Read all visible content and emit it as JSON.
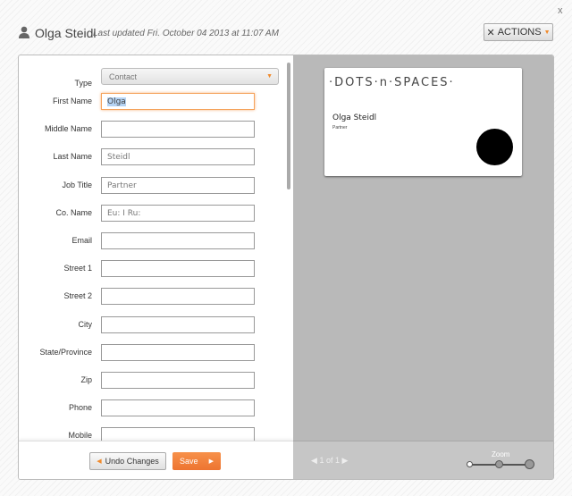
{
  "header": {
    "title": "Olga Steidl",
    "updated": "Last updated Fri. October 04 2013 at 11:07 AM",
    "actions_label": "ACTIONS",
    "close": "x"
  },
  "form": {
    "type": {
      "label": "Type",
      "value": "Contact"
    },
    "fields": [
      {
        "label": "First Name",
        "value": "Olga"
      },
      {
        "label": "Middle Name",
        "value": ""
      },
      {
        "label": "Last Name",
        "value": "Steidl"
      },
      {
        "label": "Job Title",
        "value": "Partner"
      },
      {
        "label": "Co. Name",
        "value": "Eu: I Ru:"
      },
      {
        "label": "Email",
        "value": ""
      },
      {
        "label": "Street 1",
        "value": ""
      },
      {
        "label": "Street 2",
        "value": ""
      },
      {
        "label": "City",
        "value": ""
      },
      {
        "label": "State/Province",
        "value": ""
      },
      {
        "label": "Zip",
        "value": ""
      },
      {
        "label": "Phone",
        "value": ""
      },
      {
        "label": "Mobile",
        "value": ""
      }
    ],
    "undo_label": "Undo Changes",
    "save_label": "Save"
  },
  "preview": {
    "logo": "·DOTS·n·SPACES·",
    "name": "Olga Steidl",
    "title": "Partner",
    "pager": "1 of 1",
    "zoom_label": "Zoom",
    "zoom_level": 0
  }
}
